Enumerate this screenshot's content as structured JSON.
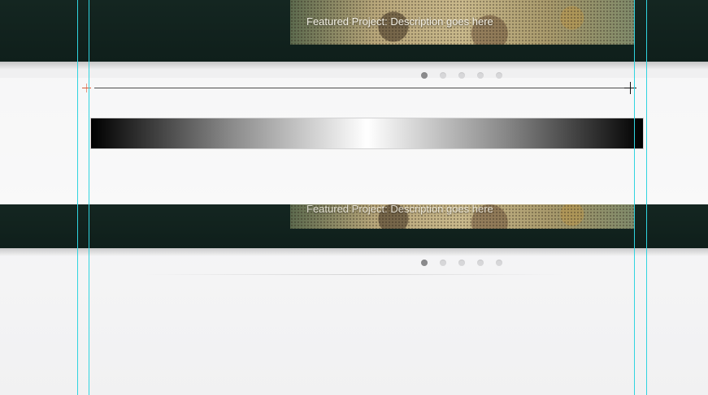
{
  "slider_top": {
    "caption": "Featured Project: Description goes here",
    "dots": 5,
    "active_dot": 1
  },
  "slider_mid": {
    "caption": "Featured Project: Description goes here",
    "dots": 5,
    "active_dot": 1
  },
  "gradient_bar": {
    "stops": [
      "#000000",
      "#ffffff",
      "#000000"
    ]
  },
  "colors": {
    "dark_band": "#142621",
    "guide": "#30d4e0",
    "ruler_start_mark": "#d65a35",
    "background": "#f2f2f3"
  }
}
